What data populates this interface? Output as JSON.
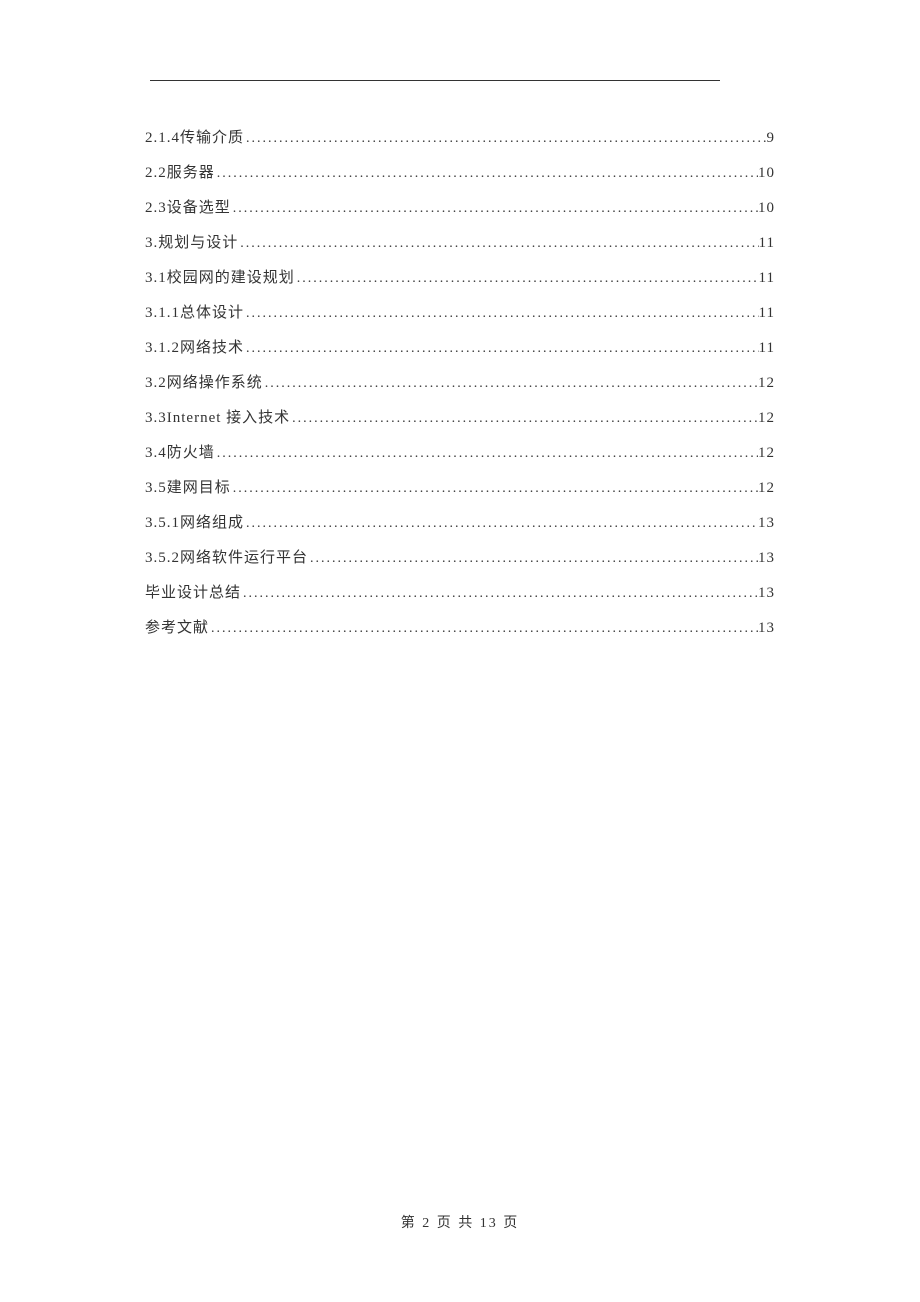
{
  "toc": [
    {
      "num": "2.1.4 ",
      "title": "传输介质",
      "page": "9"
    },
    {
      "num": "2.2  ",
      "title": "服务器",
      "page": "10"
    },
    {
      "num": "2.3  ",
      "title": "设备选型",
      "page": "10"
    },
    {
      "num": "3.  ",
      "title": "规划与设计",
      "page": "11"
    },
    {
      "num": "3.1  ",
      "title": "校园网的建设规划",
      "page": "11"
    },
    {
      "num": "3.1.1 ",
      "title": "总体设计",
      "page": "11"
    },
    {
      "num": "3.1.2 ",
      "title": "网络技术",
      "page": "11"
    },
    {
      "num": "3.2  ",
      "title": "网络操作系统",
      "page": "12"
    },
    {
      "num": "3.3  ",
      "title": "Internet 接入技术",
      "page": "12"
    },
    {
      "num": "3.4  ",
      "title": "防火墙",
      "page": "12"
    },
    {
      "num": "3.5  ",
      "title": "建网目标",
      "page": "12"
    },
    {
      "num": "3.5.1 ",
      "title": "网络组成",
      "page": "13"
    },
    {
      "num": "3.5.2 ",
      "title": "网络软件运行平台",
      "page": "13"
    },
    {
      "num": "",
      "title": "毕业设计总结",
      "page": "13"
    },
    {
      "num": "",
      "title": "参考文献",
      "page": "13"
    }
  ],
  "footer": {
    "text": "第 2 页 共 13 页"
  }
}
